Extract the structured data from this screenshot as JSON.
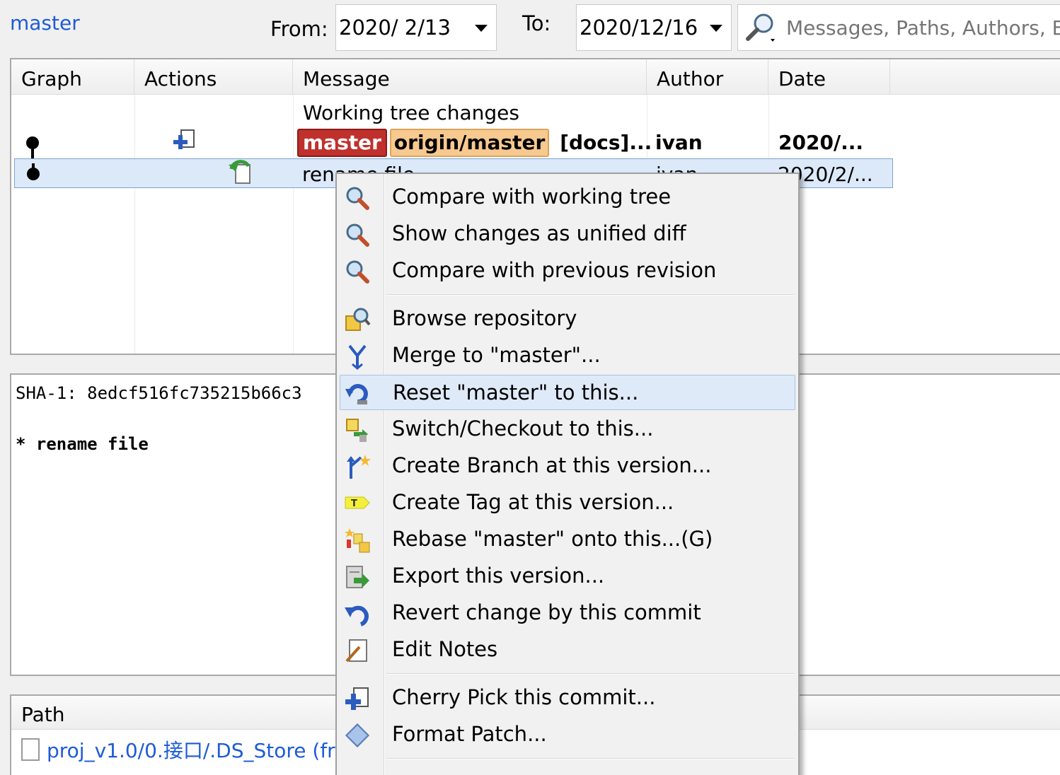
{
  "toolbar": {
    "branch": "master",
    "from_label": "From:",
    "from_date": "2020/  2/13",
    "to_label": "To:",
    "to_date": "2020/12/16",
    "search_placeholder": "Messages, Paths, Authors, Emails"
  },
  "log": {
    "columns": [
      "Graph",
      "Actions",
      "Message",
      "Author",
      "Date"
    ],
    "rows": [
      {
        "message": "Working tree changes",
        "author": "",
        "date": ""
      },
      {
        "refs": [
          "master",
          "origin/master"
        ],
        "message": "[docs]...",
        "author": "ivan",
        "date": "2020/..."
      },
      {
        "message": "rename file",
        "author": "ivan",
        "date": "2020/2/..."
      }
    ]
  },
  "details": {
    "sha": "SHA-1: 8edcf516fc735215b66c3",
    "message": "* rename file"
  },
  "files": {
    "header": "Path",
    "rows": [
      {
        "path": "proj_v1.0/0.接口/.DS_Store (fr"
      }
    ]
  },
  "context_menu": {
    "items": [
      {
        "label": "Compare with working tree",
        "icon": "magnifier-icon"
      },
      {
        "label": "Show changes as unified diff",
        "icon": "magnifier-icon"
      },
      {
        "label": "Compare with previous revision",
        "icon": "magnifier-icon"
      },
      {
        "label": "Browse repository",
        "icon": "browse-repo-icon"
      },
      {
        "label": "Merge to \"master\"...",
        "icon": "merge-icon"
      },
      {
        "label": "Reset \"master\" to this...",
        "icon": "reset-icon"
      },
      {
        "label": "Switch/Checkout to this...",
        "icon": "checkout-icon"
      },
      {
        "label": "Create Branch at this version...",
        "icon": "branch-icon"
      },
      {
        "label": "Create Tag at this version...",
        "icon": "tag-icon"
      },
      {
        "label": "Rebase \"master\" onto this...(G)",
        "icon": "rebase-icon"
      },
      {
        "label": "Export this version...",
        "icon": "export-icon"
      },
      {
        "label": "Revert change by this commit",
        "icon": "revert-icon"
      },
      {
        "label": "Edit Notes",
        "icon": "notes-icon"
      },
      {
        "label": "Cherry Pick this commit...",
        "icon": "cherry-pick-icon"
      },
      {
        "label": "Format Patch...",
        "icon": "patch-icon"
      }
    ],
    "highlighted": "Reset \"master\" to this..."
  },
  "colors": {
    "link": "#1e5bd6",
    "ref_master": "#c0302c",
    "ref_origin": "#f7c98f",
    "selection": "#dce9f9"
  }
}
